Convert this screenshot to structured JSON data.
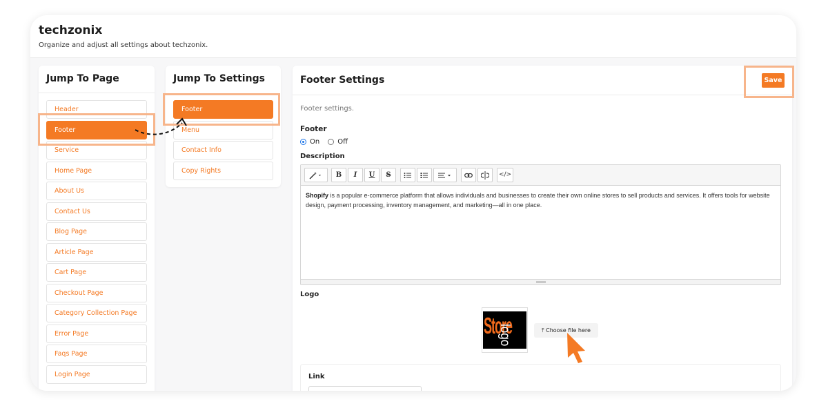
{
  "app": {
    "title": "techzonix",
    "subtitle": "Organize and adjust all settings about techzonix."
  },
  "jump_to_page": {
    "title": "Jump To Page",
    "items": [
      {
        "label": "Header",
        "active": false
      },
      {
        "label": "Footer",
        "active": true
      },
      {
        "label": "Service",
        "active": false
      },
      {
        "label": "Home Page",
        "active": false
      },
      {
        "label": "About Us",
        "active": false
      },
      {
        "label": "Contact Us",
        "active": false
      },
      {
        "label": "Blog Page",
        "active": false
      },
      {
        "label": "Article Page",
        "active": false
      },
      {
        "label": "Cart Page",
        "active": false
      },
      {
        "label": "Checkout Page",
        "active": false
      },
      {
        "label": "Category Collection Page",
        "active": false
      },
      {
        "label": "Error Page",
        "active": false
      },
      {
        "label": "Faqs Page",
        "active": false
      },
      {
        "label": "Login Page",
        "active": false
      }
    ]
  },
  "jump_to_settings": {
    "title": "Jump To Settings",
    "items": [
      {
        "label": "Footer",
        "active": true
      },
      {
        "label": "Menu",
        "active": false
      },
      {
        "label": "Contact Info",
        "active": false
      },
      {
        "label": "Copy Rights",
        "active": false
      }
    ]
  },
  "footer_settings": {
    "title": "Footer Settings",
    "save_label": "Save",
    "helper": "Footer settings.",
    "footer_label": "Footer",
    "radio_on": "On",
    "radio_off": "Off",
    "footer_enabled": true,
    "description_label": "Description",
    "description_bold": "Shopify",
    "description_rest": " is a popular e-commerce platform that allows individuals and businesses to create their own online stores to sell products and services. It offers tools for website design, payment processing, inventory management, and marketing—all in one place.",
    "logo_label": "Logo",
    "logo_text_main": "Store",
    "logo_text_side": "logo",
    "choose_file_label": "Choose file here",
    "link_label": "Link"
  },
  "toolbar": {
    "bold": "B",
    "italic": "I",
    "underline": "U",
    "strike": "S",
    "code": "</>"
  },
  "colors": {
    "accent": "#f47a24",
    "highlight": "#f7b58b",
    "radio": "#1a73e8"
  }
}
